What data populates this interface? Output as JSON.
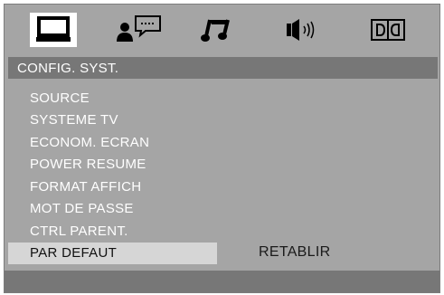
{
  "tabs": [
    {
      "icon": "monitor-icon",
      "selected": true
    },
    {
      "icon": "speaker-person-icon",
      "selected": false
    },
    {
      "icon": "music-note-icon",
      "selected": false
    },
    {
      "icon": "volume-icon",
      "selected": false
    },
    {
      "icon": "dolby-icon",
      "selected": false
    }
  ],
  "title": "CONFIG. SYST.",
  "menu": {
    "items": [
      {
        "label": "SOURCE"
      },
      {
        "label": "SYSTEME TV"
      },
      {
        "label": "ECONOM. ECRAN"
      },
      {
        "label": "POWER RESUME"
      },
      {
        "label": "FORMAT AFFICH"
      },
      {
        "label": "MOT DE PASSE"
      },
      {
        "label": "CTRL PARENT."
      },
      {
        "label": "PAR DEFAUT"
      }
    ],
    "selected_index": 7
  },
  "value": "RETABLIR",
  "colors": {
    "background": "#a5a5a5",
    "title_bar": "#777777",
    "highlight": "#d6d6d6",
    "text": "#ffffff"
  }
}
